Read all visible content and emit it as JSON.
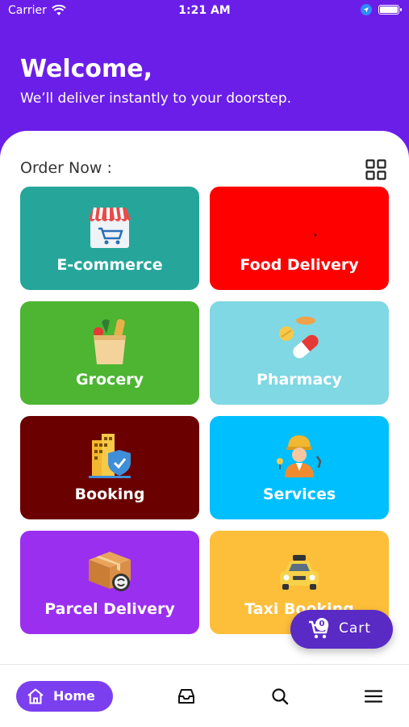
{
  "status_bar": {
    "carrier": "Carrier",
    "time": "1:21 AM"
  },
  "header": {
    "title": "Welcome,",
    "subtitle": "We’ll deliver instantly to your doorstep."
  },
  "order": {
    "label": "Order Now :"
  },
  "tiles": [
    {
      "label": "E-commerce",
      "color": "#26a69a",
      "icon": "shop-icon"
    },
    {
      "label": "Food Delivery",
      "color": "#ff0000",
      "icon": "food-icon"
    },
    {
      "label": "Grocery",
      "color": "#4db532",
      "icon": "grocery-bag-icon"
    },
    {
      "label": "Pharmacy",
      "color": "#7fd8e4",
      "icon": "pills-icon"
    },
    {
      "label": "Booking",
      "color": "#6b0000",
      "icon": "building-shield-icon"
    },
    {
      "label": "Services",
      "color": "#00bfff",
      "icon": "worker-icon"
    },
    {
      "label": "Parcel Delivery",
      "color": "#9b2ff0",
      "icon": "parcel-box-icon"
    },
    {
      "label": "Taxi Booking",
      "color": "#fdbf3a",
      "icon": "taxi-icon"
    }
  ],
  "cart": {
    "count": "0",
    "label": "Cart"
  },
  "nav": {
    "home_label": "Home"
  },
  "colors": {
    "primary": "#6b1ee8",
    "cart": "#5a2ac4",
    "home_pill": "#7b3ff0"
  }
}
